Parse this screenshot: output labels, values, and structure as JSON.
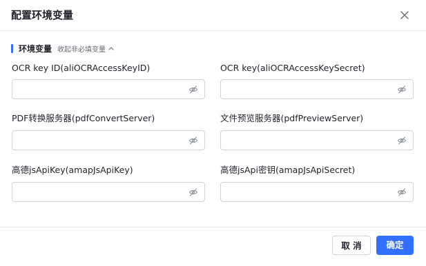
{
  "dialog": {
    "title": "配置环境变量",
    "close_icon": "close-icon"
  },
  "section": {
    "title": "环境变量",
    "collapse_label": "收起非必填变量",
    "collapse_icon": "chevron-up-icon",
    "accent_color": "#3370ff"
  },
  "fields": [
    {
      "label": "OCR key ID(aliOCRAccessKeyID)",
      "value": "",
      "icon": "eye-off-icon"
    },
    {
      "label": "OCR key(aliOCRAccessKeySecret)",
      "value": "",
      "icon": "eye-off-icon"
    },
    {
      "label": "PDF转换服务器(pdfConvertServer)",
      "value": "",
      "icon": "eye-off-icon"
    },
    {
      "label": "文件预览服务器(pdfPreviewServer)",
      "value": "",
      "icon": "eye-off-icon"
    },
    {
      "label": "高德jsApiKey(amapJsApiKey)",
      "value": "",
      "icon": "eye-off-icon"
    },
    {
      "label": "高德jsApi密钥(amapJsApiSecret)",
      "value": "",
      "icon": "eye-off-icon"
    }
  ],
  "footer": {
    "cancel_label": "取 消",
    "ok_label": "确定",
    "primary_color": "#3370ff"
  }
}
